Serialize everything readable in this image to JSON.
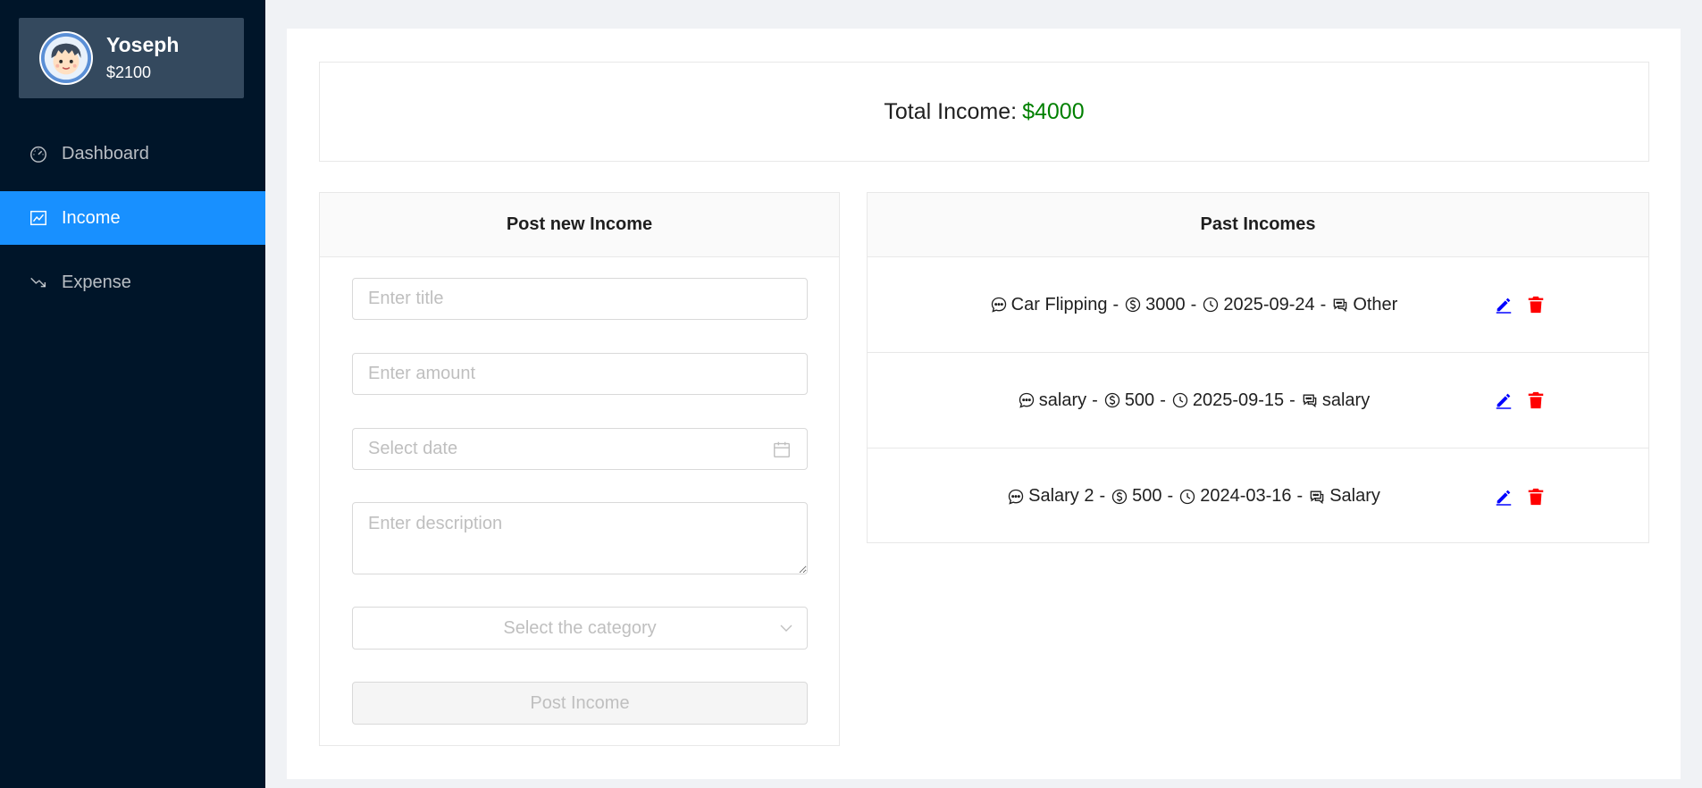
{
  "sidebar": {
    "user": {
      "name": "Yoseph",
      "balance": "$2100"
    },
    "items": [
      {
        "label": "Dashboard",
        "icon": "dashboard-icon",
        "active": false
      },
      {
        "label": "Income",
        "icon": "line-chart-icon",
        "active": true
      },
      {
        "label": "Expense",
        "icon": "fall-icon",
        "active": false
      }
    ]
  },
  "total": {
    "label": "Total Income:",
    "value": "$4000",
    "value_color": "#008000"
  },
  "post_form": {
    "title": "Post new Income",
    "title_placeholder": "Enter title",
    "amount_placeholder": "Enter amount",
    "date_placeholder": "Select date",
    "description_placeholder": "Enter description",
    "category_placeholder": "Select the category",
    "submit_label": "Post Income"
  },
  "past": {
    "title": "Past Incomes",
    "rows": [
      {
        "title": "Car Flipping",
        "amount": "3000",
        "date": "2025-09-24",
        "category": "Other"
      },
      {
        "title": "salary",
        "amount": "500",
        "date": "2025-09-15",
        "category": "salary"
      },
      {
        "title": "Salary 2",
        "amount": "500",
        "date": "2024-03-16",
        "category": "Salary"
      }
    ]
  },
  "colors": {
    "sidebar_bg": "#001529",
    "accent": "#1890ff",
    "edit": "#0000ff",
    "delete": "#ff0000"
  }
}
